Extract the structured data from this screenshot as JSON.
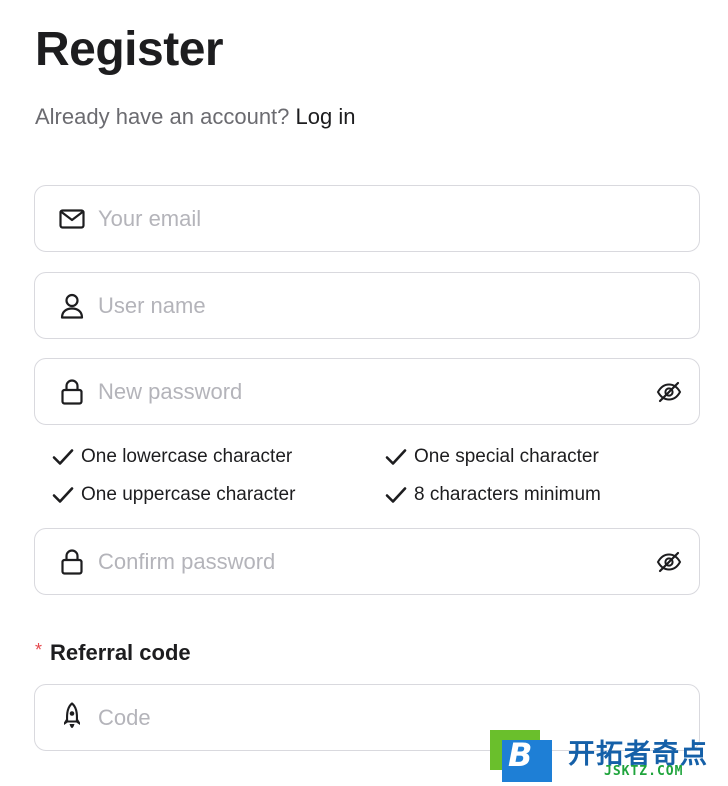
{
  "header": {
    "title": "Register",
    "account_prompt": "Already have an account?",
    "login_link": "Log in"
  },
  "form": {
    "email": {
      "placeholder": "Your email",
      "value": "",
      "icon": "mail-icon"
    },
    "username": {
      "placeholder": "User name",
      "value": "",
      "icon": "user-icon"
    },
    "new_password": {
      "placeholder": "New password",
      "value": "",
      "icon": "lock-icon",
      "toggle_icon": "eye-off-icon"
    },
    "confirm_password": {
      "placeholder": "Confirm password",
      "value": "",
      "icon": "lock-icon",
      "toggle_icon": "eye-off-icon"
    },
    "password_rules": [
      {
        "label": "One lowercase character",
        "met": true
      },
      {
        "label": "One special character",
        "met": true
      },
      {
        "label": "One uppercase character",
        "met": true
      },
      {
        "label": "8 characters minimum",
        "met": true
      }
    ],
    "referral": {
      "required_marker": "*",
      "label": "Referral code",
      "placeholder": "Code",
      "value": "",
      "icon": "rocket-icon"
    }
  },
  "watermark": {
    "logo_letter": "B",
    "name_cn": "开拓者奇点",
    "domain": "JSKTZ.COM"
  },
  "colors": {
    "text": "#1d1d1f",
    "muted": "#6b6b70",
    "placeholder": "#b4b4ba",
    "border": "#d9d9de",
    "required": "#e5484d",
    "watermark_blue": "#1560a8",
    "watermark_green": "#1fa43c"
  }
}
